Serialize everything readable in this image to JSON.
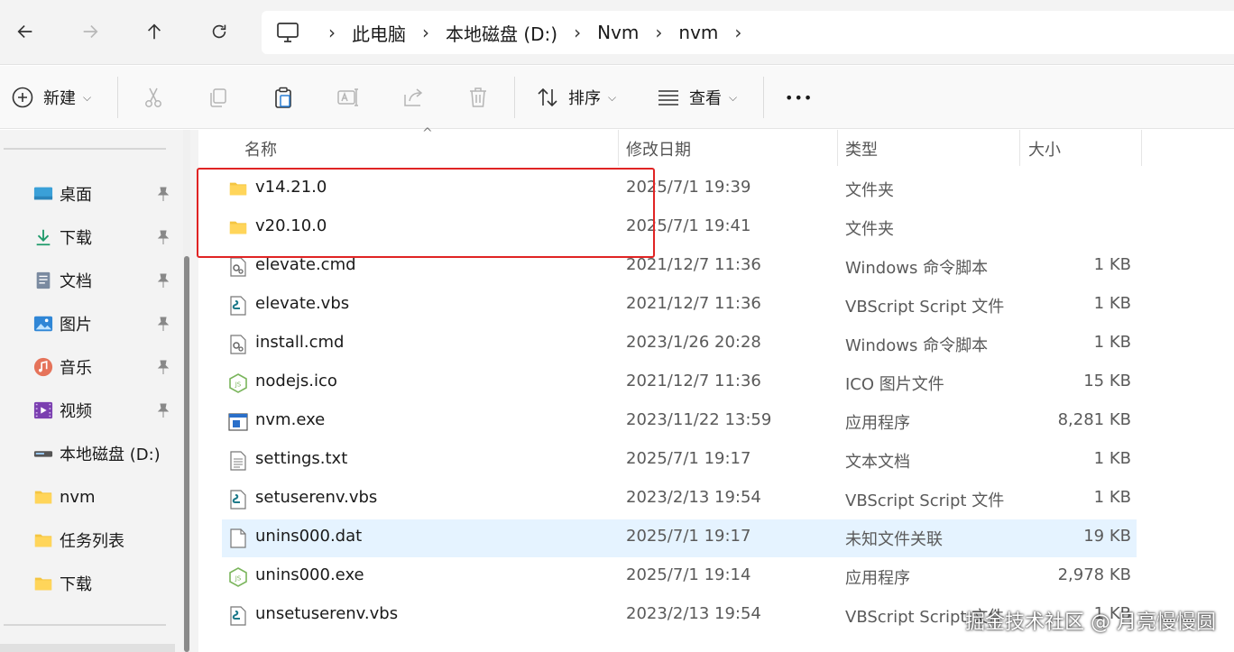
{
  "nav": {
    "breadcrumb": [
      "此电脑",
      "本地磁盘 (D:)",
      "Nvm",
      "nvm"
    ]
  },
  "toolbar": {
    "new_label": "新建",
    "sort_label": "排序",
    "view_label": "查看",
    "more_label": "•••"
  },
  "sidebar": {
    "items": [
      {
        "label": "桌面",
        "icon": "desktop-icon",
        "pinned": true
      },
      {
        "label": "下载",
        "icon": "download-icon",
        "pinned": true
      },
      {
        "label": "文档",
        "icon": "document-icon",
        "pinned": true
      },
      {
        "label": "图片",
        "icon": "pictures-icon",
        "pinned": true
      },
      {
        "label": "音乐",
        "icon": "music-icon",
        "pinned": true
      },
      {
        "label": "视频",
        "icon": "video-icon",
        "pinned": true
      },
      {
        "label": "本地磁盘 (D:)",
        "icon": "drive-icon",
        "pinned": false
      },
      {
        "label": "nvm",
        "icon": "folder-icon",
        "pinned": false
      },
      {
        "label": "任务列表",
        "icon": "folder-icon",
        "pinned": false
      },
      {
        "label": "下载",
        "icon": "folder-icon",
        "pinned": false
      }
    ]
  },
  "columns": {
    "name": "名称",
    "date": "修改日期",
    "type": "类型",
    "size": "大小"
  },
  "files": [
    {
      "name": "v14.21.0",
      "date": "2025/7/1 19:39",
      "type": "文件夹",
      "size": "",
      "icon": "folder-icon"
    },
    {
      "name": "v20.10.0",
      "date": "2025/7/1 19:41",
      "type": "文件夹",
      "size": "",
      "icon": "folder-icon"
    },
    {
      "name": "elevate.cmd",
      "date": "2021/12/7 11:36",
      "type": "Windows 命令脚本",
      "size": "1 KB",
      "icon": "cmd-script-icon"
    },
    {
      "name": "elevate.vbs",
      "date": "2021/12/7 11:36",
      "type": "VBScript Script 文件",
      "size": "1 KB",
      "icon": "vbs-script-icon"
    },
    {
      "name": "install.cmd",
      "date": "2023/1/26 20:28",
      "type": "Windows 命令脚本",
      "size": "1 KB",
      "icon": "cmd-script-icon"
    },
    {
      "name": "nodejs.ico",
      "date": "2021/12/7 11:36",
      "type": "ICO 图片文件",
      "size": "15 KB",
      "icon": "nodejs-icon"
    },
    {
      "name": "nvm.exe",
      "date": "2023/11/22 13:59",
      "type": "应用程序",
      "size": "8,281 KB",
      "icon": "exe-icon"
    },
    {
      "name": "settings.txt",
      "date": "2025/7/1 19:17",
      "type": "文本文档",
      "size": "1 KB",
      "icon": "text-file-icon"
    },
    {
      "name": "setuserenv.vbs",
      "date": "2023/2/13 19:54",
      "type": "VBScript Script 文件",
      "size": "1 KB",
      "icon": "vbs-script-icon"
    },
    {
      "name": "unins000.dat",
      "date": "2025/7/1 19:17",
      "type": "未知文件关联",
      "size": "19 KB",
      "icon": "blank-file-icon",
      "selected": true
    },
    {
      "name": "unins000.exe",
      "date": "2025/7/1 19:14",
      "type": "应用程序",
      "size": "2,978 KB",
      "icon": "nodejs-icon"
    },
    {
      "name": "unsetuserenv.vbs",
      "date": "2023/2/13 19:54",
      "type": "VBScript Script 文件",
      "size": "1 KB",
      "icon": "vbs-script-icon"
    }
  ],
  "watermark": "掘金技术社区 @ 月亮慢慢圆",
  "colors": {
    "highlight_box": "#e02424",
    "selected_row": "#e5f3ff",
    "folder": "#f4c542"
  }
}
